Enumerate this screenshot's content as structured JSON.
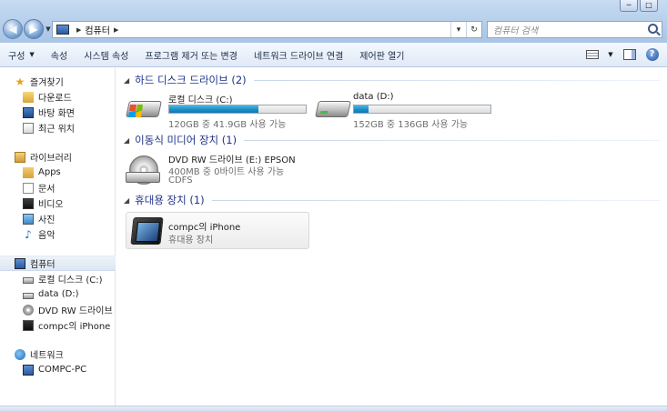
{
  "window": {
    "controls": {
      "minimize": "─",
      "maximize": "□"
    }
  },
  "address_bar": {
    "crumbs": [
      "컴퓨터"
    ],
    "refresh": "↻",
    "dropdown": "▾"
  },
  "search": {
    "placeholder": "컴퓨터 검색"
  },
  "toolbar": {
    "items": [
      {
        "label": "구성",
        "has_dropdown": true
      },
      {
        "label": "속성"
      },
      {
        "label": "시스템 속성"
      },
      {
        "label": "프로그램 제거 또는 변경"
      },
      {
        "label": "네트워크 드라이브 연결"
      },
      {
        "label": "제어판 열기"
      }
    ],
    "help": "?"
  },
  "sidebar": {
    "favorites": {
      "title": "즐겨찾기",
      "items": [
        {
          "label": "다운로드",
          "icon": "download-folder-icon"
        },
        {
          "label": "바탕 화면",
          "icon": "desktop-icon"
        },
        {
          "label": "최근 위치",
          "icon": "recent-places-icon"
        }
      ]
    },
    "libraries": {
      "title": "라이브러리",
      "items": [
        {
          "label": "Apps",
          "icon": "folder-icon"
        },
        {
          "label": "문서",
          "icon": "documents-icon"
        },
        {
          "label": "비디오",
          "icon": "video-icon"
        },
        {
          "label": "사진",
          "icon": "pictures-icon"
        },
        {
          "label": "음악",
          "icon": "music-icon"
        }
      ]
    },
    "computer": {
      "title": "컴퓨터",
      "items": [
        {
          "label": "로컬 디스크 (C:)",
          "icon": "local-disk-icon"
        },
        {
          "label": "data (D:)",
          "icon": "drive-icon"
        },
        {
          "label": "DVD RW 드라이브 (",
          "icon": "dvd-drive-icon"
        },
        {
          "label": "compc의 iPhone",
          "icon": "iphone-icon"
        }
      ]
    },
    "network": {
      "title": "네트워크",
      "items": [
        {
          "label": "COMPC-PC",
          "icon": "computer-icon"
        }
      ]
    }
  },
  "content": {
    "groups": {
      "hdd": {
        "title": "하드 디스크 드라이브 (2)"
      },
      "removable": {
        "title": "이동식 미디어 장치 (1)"
      },
      "portable": {
        "title": "휴대용 장치 (1)"
      }
    },
    "drives": {
      "c": {
        "name": "로컬 디스크 (C:)",
        "info": "120GB 중 41.9GB 사용 가능",
        "used_fraction": 0.65
      },
      "d": {
        "name": "data (D:)",
        "info": "152GB 중 136GB 사용 가능",
        "used_fraction": 0.105
      },
      "e": {
        "name": "DVD RW 드라이브 (E:) EPSON",
        "info": "400MB 중 0바이트 사용 가능",
        "fs": "CDFS"
      }
    },
    "portable_device": {
      "name": "compc의 iPhone",
      "type": "휴대용 장치"
    }
  }
}
